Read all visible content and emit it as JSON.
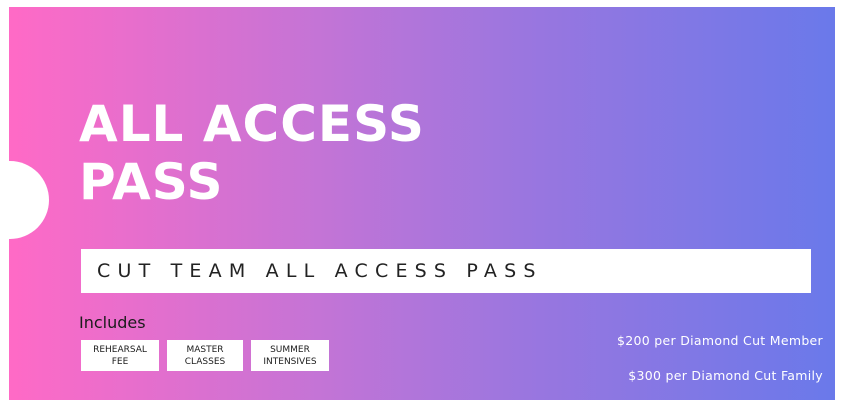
{
  "pass": {
    "title": "ALL ACCESS\nPASS",
    "subtitle": "CUT TEAM ALL ACCESS PASS",
    "includes_label": "Includes",
    "badges": [
      "REHEARSAL\nFEE",
      "MASTER\nCLASSES",
      "SUMMER\nINTENSIVES"
    ],
    "prices": [
      "$200 per Diamond Cut Member",
      "$300 per Diamond Cut Family"
    ]
  },
  "colors": {
    "gradient_start": "#ff6ac6",
    "gradient_end": "#6a79ea",
    "text_light": "#ffffff",
    "panel_white": "#ffffff"
  }
}
